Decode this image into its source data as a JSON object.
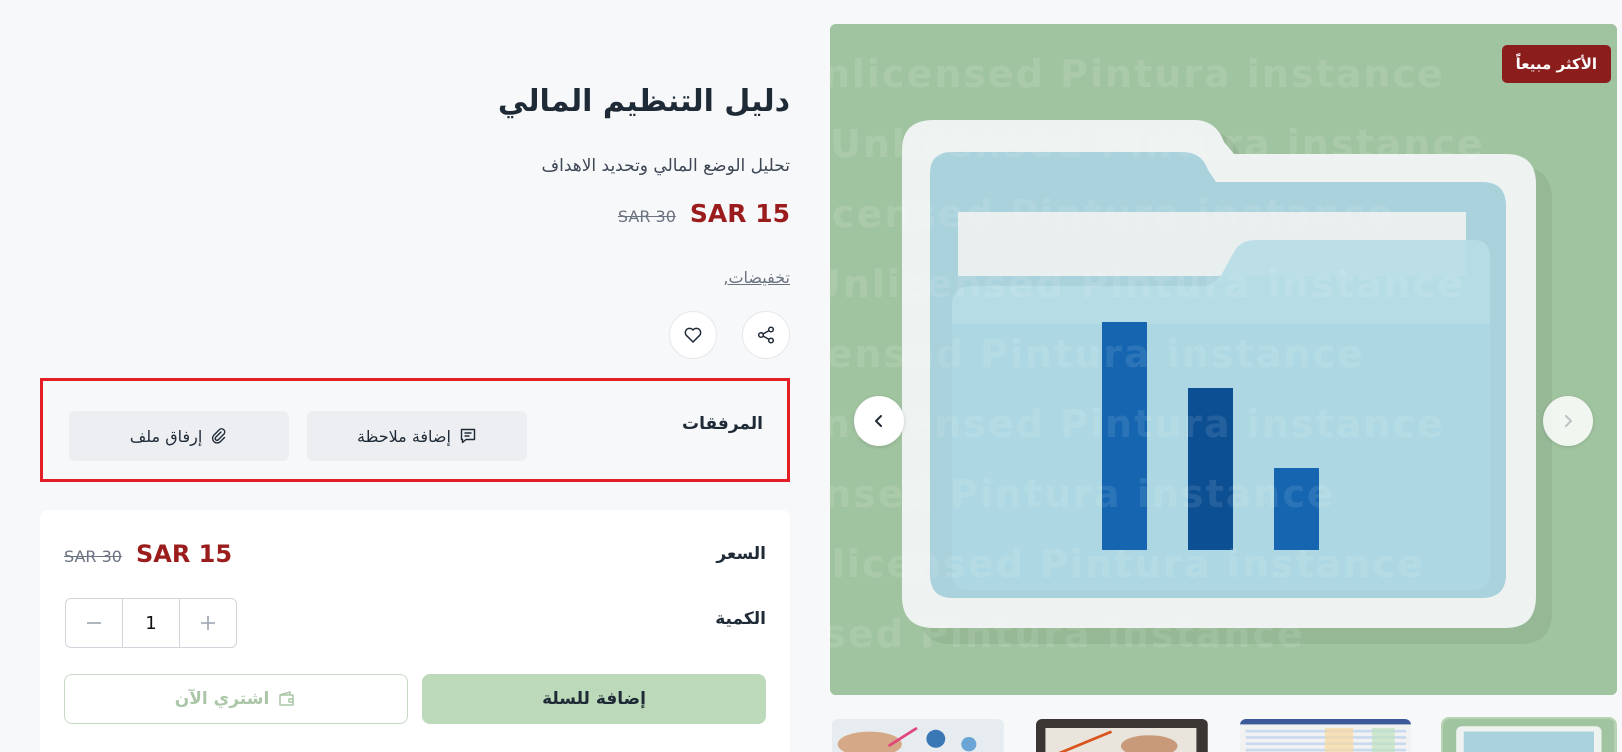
{
  "product": {
    "title": "دليل التنظيم المالي",
    "subtitle": "تحليل الوضع المالي وتحديد الاهداف",
    "price_now": "SAR 15",
    "price_old": "SAR 30",
    "tags": "تخفيضات,"
  },
  "gallery": {
    "badge": "الأكثر مبيعاً",
    "watermark": "Unlicensed Pintura instance",
    "main_icon": "folder-bar-chart-image",
    "thumbnails": [
      "folder-chart-thumb",
      "spreadsheet-thumb",
      "hand-writing-thumb",
      "hand-charts-thumb"
    ]
  },
  "actions": {
    "share_icon": "share-icon",
    "wishlist_icon": "heart-icon"
  },
  "attachments": {
    "label": "المرفقات",
    "add_note_label": "إضافة ملاحظة",
    "attach_file_label": "إرفاق ملف"
  },
  "purchase": {
    "price_label": "السعر",
    "price_now": "SAR 15",
    "price_old": "SAR 30",
    "quantity_label": "الكمية",
    "quantity": "1",
    "add_to_cart_label": "إضافة للسلة",
    "buy_now_label": "اشتري الآن"
  },
  "colors": {
    "accent_red": "#9b1c1c",
    "badge_red": "#8c1d1d",
    "cart_green": "#bcd9b9",
    "highlight_border": "#e31e24"
  }
}
